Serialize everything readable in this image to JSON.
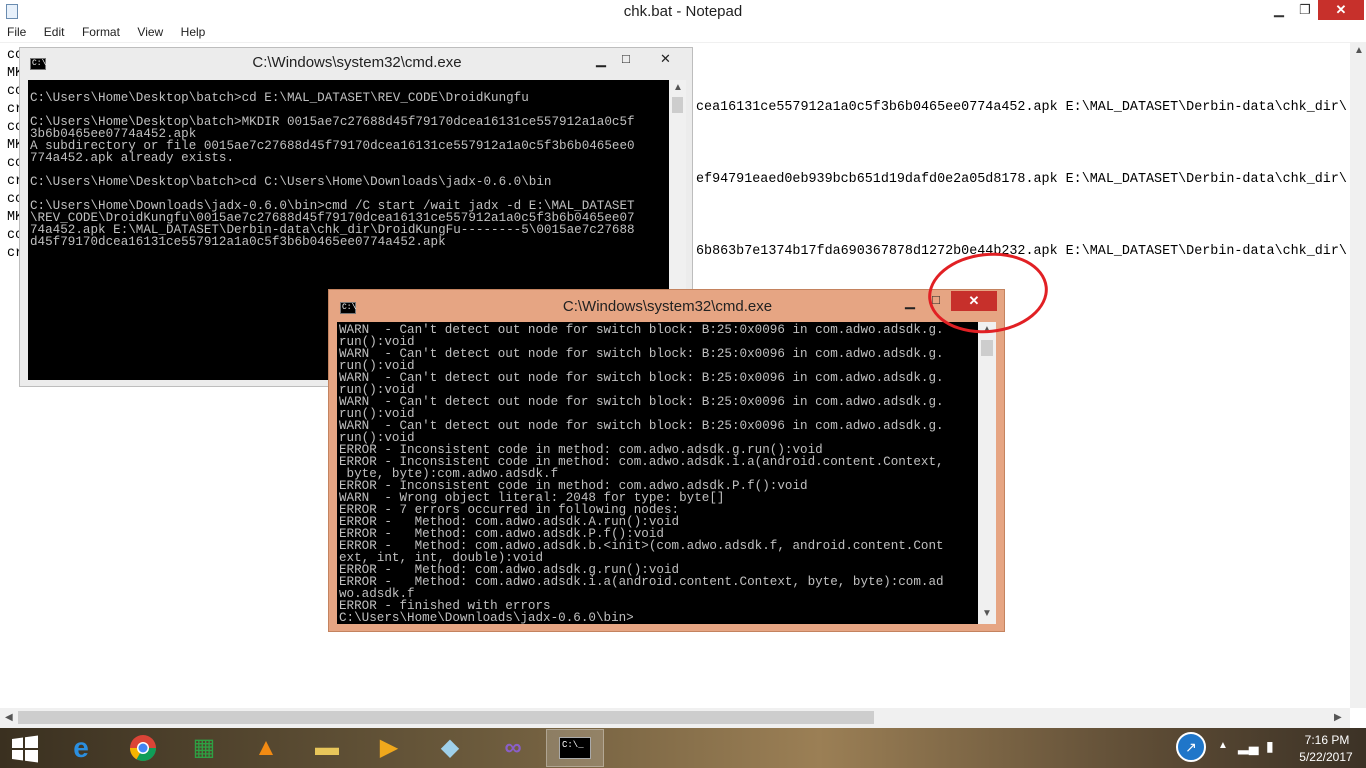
{
  "notepad": {
    "title": "chk.bat - Notepad",
    "window_controls": {
      "minimize": "▁",
      "maximize": "❐",
      "close": "✕"
    },
    "menu": [
      "File",
      "Edit",
      "Format",
      "View",
      "Help"
    ],
    "left_lines": [
      "cc",
      "MK",
      "cc",
      "cr",
      "cc",
      "MK",
      "cc",
      "cr",
      "cc",
      "MK",
      "cc",
      "cr"
    ],
    "right_lines": [
      "cea16131ce557912a1a0c5f3b6b0465ee0774a452.apk E:\\MAL_DATASET\\Derbin-data\\chk_dir\\",
      "ef94791eaed0eb939bcb651d19dafd0e2a05d8178.apk E:\\MAL_DATASET\\Derbin-data\\chk_dir\\",
      "6b863b7e1374b17fda690367878d1272b0e44b232.apk E:\\MAL_DATASET\\Derbin-data\\chk_dir\\"
    ]
  },
  "cmd1": {
    "title": "C:\\Windows\\system32\\cmd.exe",
    "icon_text": "C:\\",
    "lines": [
      "C:\\Users\\Home\\Desktop\\batch>cd E:\\MAL_DATASET\\REV_CODE\\DroidKungfu",
      "",
      "C:\\Users\\Home\\Desktop\\batch>MKDIR 0015ae7c27688d45f79170dcea16131ce557912a1a0c5f",
      "3b6b0465ee0774a452.apk",
      "A subdirectory or file 0015ae7c27688d45f79170dcea16131ce557912a1a0c5f3b6b0465ee0",
      "774a452.apk already exists.",
      "",
      "C:\\Users\\Home\\Desktop\\batch>cd C:\\Users\\Home\\Downloads\\jadx-0.6.0\\bin",
      "",
      "C:\\Users\\Home\\Downloads\\jadx-0.6.0\\bin>cmd /C start /wait jadx -d E:\\MAL_DATASET",
      "\\REV_CODE\\DroidKungfu\\0015ae7c27688d45f79170dcea16131ce557912a1a0c5f3b6b0465ee07",
      "74a452.apk E:\\MAL_DATASET\\Derbin-data\\chk_dir\\DroidKungFu--------5\\0015ae7c27688",
      "d45f79170dcea16131ce557912a1a0c5f3b6b0465ee0774a452.apk"
    ]
  },
  "cmd2": {
    "title": "C:\\Windows\\system32\\cmd.exe",
    "icon_text": "C:\\",
    "lines": [
      "WARN  - Can't detect out node for switch block: B:25:0x0096 in com.adwo.adsdk.g.",
      "run():void",
      "WARN  - Can't detect out node for switch block: B:25:0x0096 in com.adwo.adsdk.g.",
      "run():void",
      "WARN  - Can't detect out node for switch block: B:25:0x0096 in com.adwo.adsdk.g.",
      "run():void",
      "WARN  - Can't detect out node for switch block: B:25:0x0096 in com.adwo.adsdk.g.",
      "run():void",
      "WARN  - Can't detect out node for switch block: B:25:0x0096 in com.adwo.adsdk.g.",
      "run():void",
      "ERROR - Inconsistent code in method: com.adwo.adsdk.g.run():void",
      "ERROR - Inconsistent code in method: com.adwo.adsdk.i.a(android.content.Context,",
      " byte, byte):com.adwo.adsdk.f",
      "ERROR - Inconsistent code in method: com.adwo.adsdk.P.f():void",
      "WARN  - Wrong object literal: 2048 for type: byte[]",
      "ERROR - 7 errors occurred in following nodes:",
      "ERROR -   Method: com.adwo.adsdk.A.run():void",
      "ERROR -   Method: com.adwo.adsdk.P.f():void",
      "ERROR -   Method: com.adwo.adsdk.b.<init>(com.adwo.adsdk.f, android.content.Cont",
      "ext, int, int, double):void",
      "ERROR -   Method: com.adwo.adsdk.g.run():void",
      "ERROR -   Method: com.adwo.adsdk.i.a(android.content.Context, byte, byte):com.ad",
      "wo.adsdk.f",
      "ERROR - finished with errors",
      "C:\\Users\\Home\\Downloads\\jadx-0.6.0\\bin>"
    ]
  },
  "taskbar": {
    "apps": [
      {
        "name": "internet-explorer",
        "glyph": "e",
        "color": "#2b8fe0"
      },
      {
        "name": "chrome",
        "glyph": "◉",
        "color": "#e0b020"
      },
      {
        "name": "store",
        "glyph": "▦",
        "color": "#2ea043"
      },
      {
        "name": "vlc",
        "glyph": "▲",
        "color": "#f28a12"
      },
      {
        "name": "file-explorer",
        "glyph": "▬",
        "color": "#e8c65a"
      },
      {
        "name": "media-player",
        "glyph": "▶",
        "color": "#f0a81c"
      },
      {
        "name": "notepad",
        "glyph": "◆",
        "color": "#9fd0ea"
      },
      {
        "name": "visual-studio",
        "glyph": "∞",
        "color": "#8a5fc8"
      },
      {
        "name": "cmd",
        "glyph": "C:\\_",
        "color": "#ffffff"
      }
    ],
    "time": "7:16 PM",
    "date": "5/22/2017"
  }
}
